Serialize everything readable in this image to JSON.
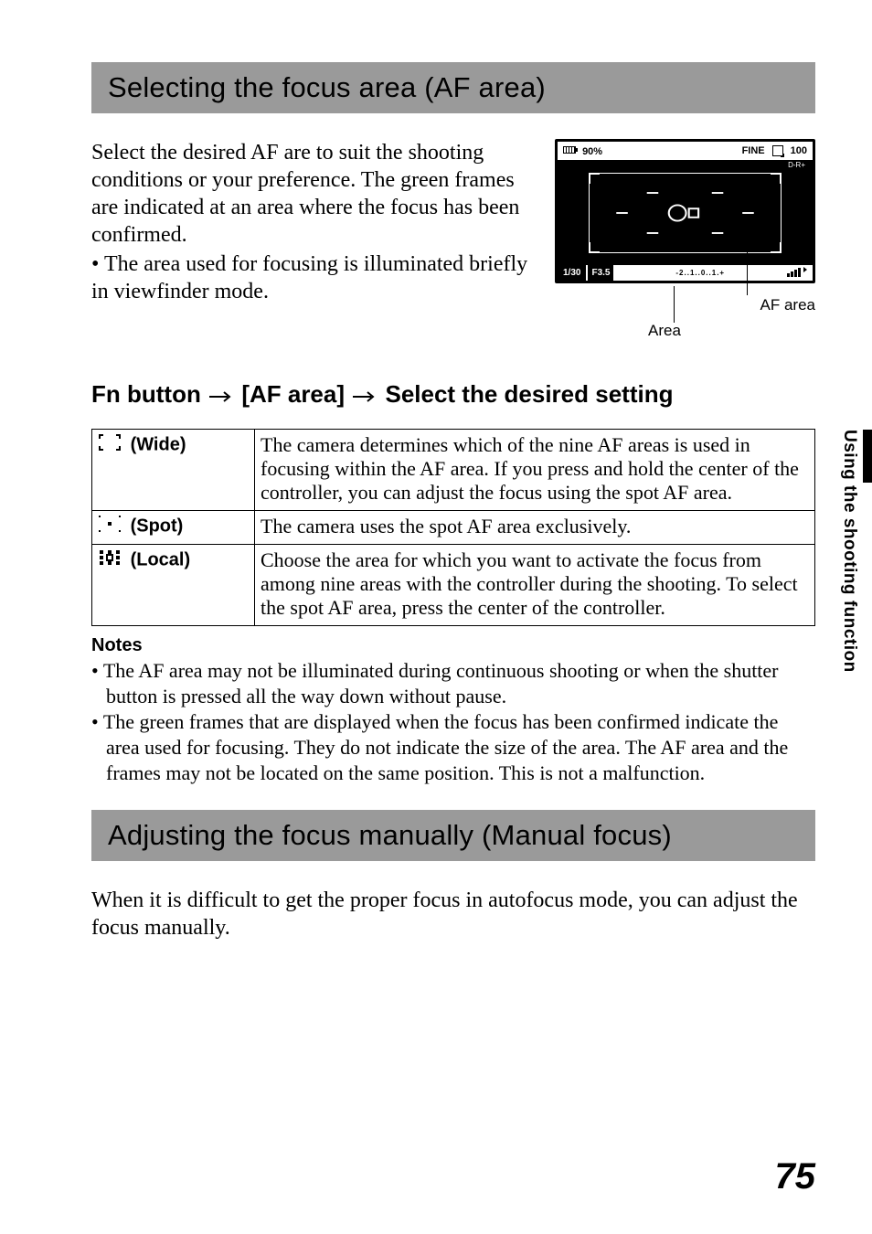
{
  "page_number": "75",
  "side_tab": "Using the shooting function",
  "section1": {
    "title": "Selecting the focus area (AF area)",
    "intro_p1": "Select the desired AF are to suit the shooting conditions or your preference. The green frames are indicated at an area where the focus has been confirmed.",
    "intro_bullet": "The area used for focusing is illuminated briefly in viewfinder mode.",
    "screen": {
      "battery_pct": "90%",
      "fine": "FINE",
      "remaining": "100",
      "dro": "D-R+",
      "shutter": "1/30",
      "aperture": "F3.5",
      "ev_scale": "-2..1..0..1.+",
      "label_af_area": "AF area",
      "label_area": "Area"
    },
    "subhead_parts": {
      "a": "Fn button",
      "b": "[AF area]",
      "c": "Select the desired setting"
    },
    "table": {
      "rows": [
        {
          "key": "(Wide)",
          "icon": "af-wide-icon",
          "val": "The camera determines which of the nine AF areas is used in focusing within the AF area. If you press and hold the center of the controller, you can adjust the focus using the spot AF area."
        },
        {
          "key": "(Spot)",
          "icon": "af-spot-icon",
          "val": "The camera uses the spot AF area exclusively."
        },
        {
          "key": "(Local)",
          "icon": "af-local-icon",
          "val": "Choose the area for which you want to activate the focus from among nine areas with the controller during the shooting. To select the spot AF area, press the center of the controller."
        }
      ]
    },
    "notes_heading": "Notes",
    "notes": [
      "The AF area may not be illuminated during continuous shooting or when the shutter button is pressed all the way down without pause.",
      "The green frames that are displayed when the focus has been confirmed indicate the area used for focusing. They do not indicate the size of the area. The AF area and the frames may not be located on the same position. This is not a malfunction."
    ]
  },
  "section2": {
    "title": "Adjusting the focus manually (Manual focus)",
    "body": "When it is difficult to get the proper focus in autofocus mode, you can adjust the focus manually."
  }
}
